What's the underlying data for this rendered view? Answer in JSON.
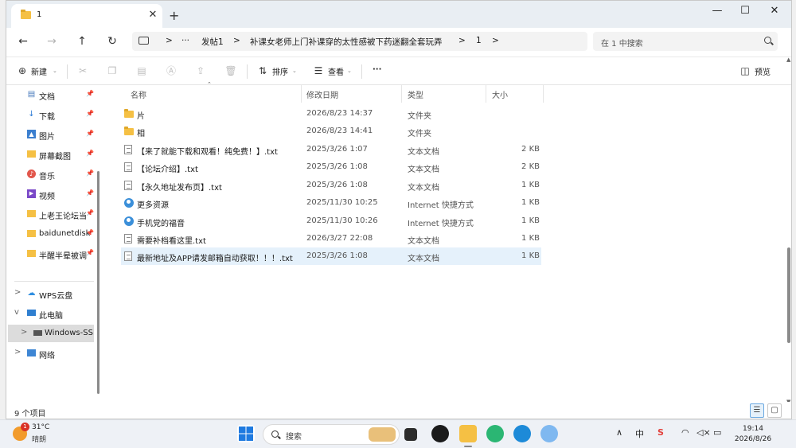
{
  "tab": {
    "title": "1",
    "close": "✕",
    "new": "+"
  },
  "window_controls": {
    "minimize": "—",
    "maximize": "☐",
    "close": "✕"
  },
  "nav": {
    "back": "←",
    "forward": "→",
    "up": "↑",
    "refresh": "↻",
    "breadcrumb": [
      ">",
      "···",
      "发帖1",
      ">",
      "补课女老师上门补课穿的太性感被下药迷翻全套玩弄",
      ">",
      "1",
      ">"
    ],
    "search_placeholder": "在 1 中搜索"
  },
  "toolbar": {
    "new_label": "新建",
    "sort_label": "排序",
    "view_label": "查看",
    "more_label": "···",
    "preview_label": "预览"
  },
  "sidebar": {
    "quick": [
      {
        "label": "文档",
        "icon": "document-icon"
      },
      {
        "label": "下载",
        "icon": "download-icon"
      },
      {
        "label": "图片",
        "icon": "picture-icon"
      },
      {
        "label": "屏幕截图",
        "icon": "folder-icon"
      },
      {
        "label": "音乐",
        "icon": "music-icon"
      },
      {
        "label": "视频",
        "icon": "video-icon"
      },
      {
        "label": "上老王论坛当",
        "icon": "folder-icon"
      },
      {
        "label": "baidunetdisk",
        "icon": "folder-icon"
      },
      {
        "label": "半醒半晕被调",
        "icon": "folder-icon"
      }
    ],
    "tree": [
      {
        "label": "WPS云盘",
        "icon": "cloud-icon",
        "chev": ">"
      },
      {
        "label": "此电脑",
        "icon": "computer-icon",
        "chev": "v"
      },
      {
        "label": "Windows-SSD",
        "icon": "drive-icon",
        "chev": ">"
      },
      {
        "label": "网络",
        "icon": "network-icon",
        "chev": ">"
      }
    ]
  },
  "columns": {
    "name": "名称",
    "date": "修改日期",
    "type": "类型",
    "size": "大小"
  },
  "files": [
    {
      "name": "片",
      "date": "2026/8/23 14:37",
      "type": "文件夹",
      "size": "",
      "kind": "folder"
    },
    {
      "name": "相",
      "date": "2026/8/23 14:41",
      "type": "文件夹",
      "size": "",
      "kind": "folder"
    },
    {
      "name": "【来了就能下载和观看！纯免费！】.txt",
      "date": "2025/3/26 1:07",
      "type": "文本文档",
      "size": "2 KB",
      "kind": "txt"
    },
    {
      "name": "【论坛介绍】.txt",
      "date": "2025/3/26 1:08",
      "type": "文本文档",
      "size": "2 KB",
      "kind": "txt"
    },
    {
      "name": "【永久地址发布页】.txt",
      "date": "2025/3/26 1:08",
      "type": "文本文档",
      "size": "1 KB",
      "kind": "txt"
    },
    {
      "name": "更多资源",
      "date": "2025/11/30 10:25",
      "type": "Internet 快捷方式",
      "size": "1 KB",
      "kind": "link"
    },
    {
      "name": "手机党的福音",
      "date": "2025/11/30 10:26",
      "type": "Internet 快捷方式",
      "size": "1 KB",
      "kind": "link"
    },
    {
      "name": "需要补档看这里.txt",
      "date": "2026/3/27 22:08",
      "type": "文本文档",
      "size": "1 KB",
      "kind": "txt"
    },
    {
      "name": "最新地址及APP请发邮箱自动获取！！！.txt",
      "date": "2025/3/26 1:08",
      "type": "文本文档",
      "size": "1 KB",
      "kind": "txt"
    }
  ],
  "status": {
    "count": "9 个项目"
  },
  "taskbar": {
    "weather_badge": "1",
    "temp": "31°C",
    "condition": "晴朗",
    "search": "搜索",
    "tray_ime": "中",
    "time": "19:14",
    "date": "2026/8/26"
  }
}
